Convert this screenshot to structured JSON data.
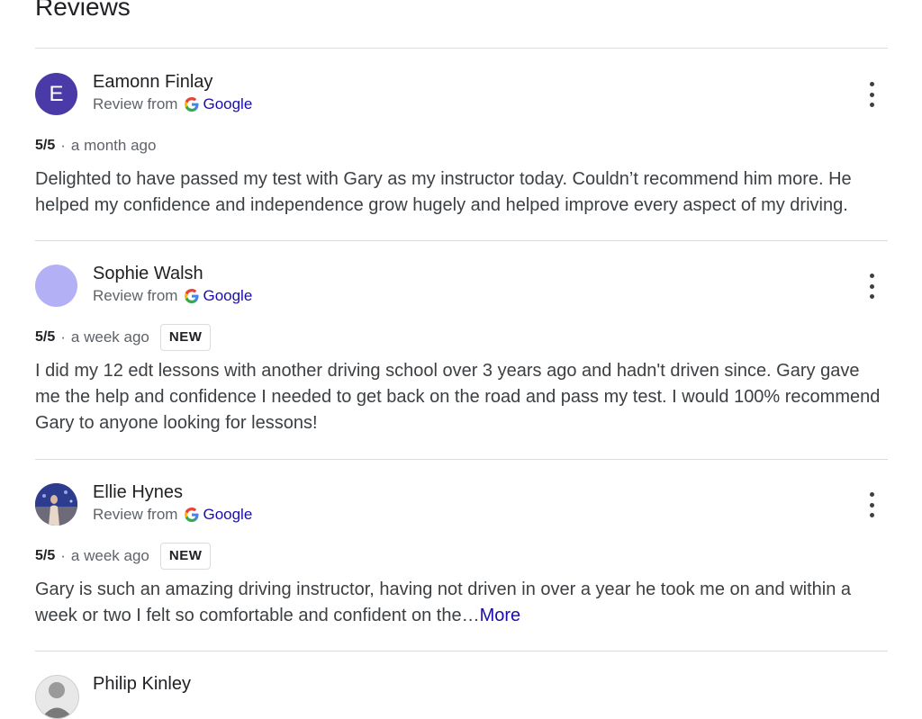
{
  "section": {
    "title": "Reviews"
  },
  "reviews": [
    {
      "author": "Eamonn Finlay",
      "avatar_letter": "E",
      "avatar_color": "#4a3aa8",
      "source_prefix": "Review from",
      "source_name": "Google",
      "rating": "5/5",
      "separator": "·",
      "time": "a month ago",
      "badge": "",
      "text": "Delighted to have passed my test with Gary as my instructor today. Couldn’t recommend him more. He helped my confidence and independence grow hugely and helped improve every aspect of my driving.",
      "more": ""
    },
    {
      "author": "Sophie Walsh",
      "avatar_letter": "",
      "avatar_color": "#b3b0f5",
      "source_prefix": "Review from",
      "source_name": "Google",
      "rating": "5/5",
      "separator": "·",
      "time": "a week ago",
      "badge": "NEW",
      "text": "I did my 12 edt lessons with another driving school over 3 years ago and hadn't driven since. Gary gave me the help and confidence I needed to get back on the road and pass my test. I would 100% recommend Gary to anyone looking for lessons!",
      "more": ""
    },
    {
      "author": "Ellie Hynes",
      "avatar_letter": "",
      "avatar_color": "#2e3c8f",
      "source_prefix": "Review from",
      "source_name": "Google",
      "rating": "5/5",
      "separator": "·",
      "time": "a week ago",
      "badge": "NEW",
      "text": "Gary is such an amazing driving instructor, having not driven in over a year he took me on and within a week or two I felt so comfortable and confident on the…",
      "more": "More"
    },
    {
      "author": "Philip Kinley"
    }
  ],
  "icons": {
    "source": "google-g-icon",
    "menu": "more-vert-icon"
  }
}
